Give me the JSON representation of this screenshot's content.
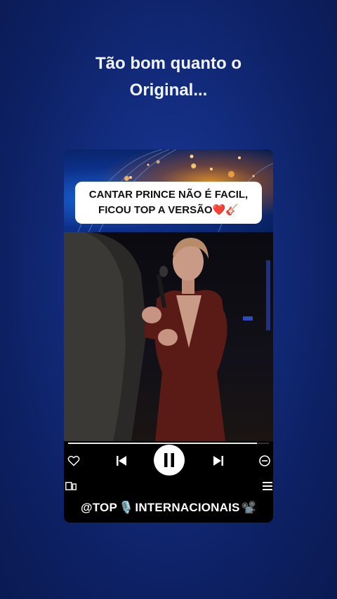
{
  "headline": {
    "line1": "Tão bom quanto o",
    "line2": "Original..."
  },
  "caption": {
    "line1": "CANTAR PRINCE NÃO É FACIL,",
    "line2": "FICOU TOP A VERSÃO❤️🎸"
  },
  "player": {
    "progress": 0.94,
    "icons": {
      "like": "heart-icon",
      "previous": "skip-previous-icon",
      "pause": "pause-icon",
      "next": "skip-next-icon",
      "remove": "minus-circle-icon",
      "devices": "cast-devices-icon",
      "queue": "queue-icon"
    }
  },
  "footer": {
    "prefix": "@TOP",
    "mic": "🎙️",
    "name": "INTERNACIONAIS",
    "camera": "📽️"
  },
  "colors": {
    "background": "#132d80",
    "accent": "#ffffff"
  }
}
